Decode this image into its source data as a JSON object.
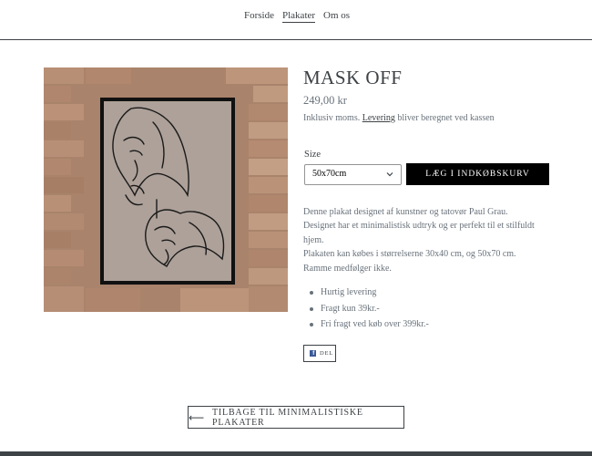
{
  "nav": {
    "items": [
      {
        "label": "Forside"
      },
      {
        "label": "Plakater"
      },
      {
        "label": "Om os"
      }
    ]
  },
  "product": {
    "title": "MASK OFF",
    "price": "249,00 kr",
    "tax_prefix": "Inklusiv moms. ",
    "tax_link": "Levering",
    "tax_suffix": " bliver beregnet ved kassen",
    "size_label": "Size",
    "size_selected": "50x70cm",
    "add_to_cart": "LÆG I INDKØBSKURV",
    "description": [
      "Denne plakat designet af kunstner og tatovør Paul Grau.",
      "Designet har et minimalistisk udtryk og er perfekt til et stilfuldt hjem.",
      "Plakaten kan købes i størrelserne 30x40 cm, og 50x70 cm.",
      "Ramme medfølger ikke."
    ],
    "bullets": [
      "Hurtig levering",
      "Fragt kun 39kr.-",
      "Fri fragt ved køb over 399kr.-"
    ],
    "share_label": "DEL"
  },
  "back_button": "TILBAGE TIL MINIMALISTISKE PLAKATER",
  "colors": {
    "text": "#3d4246",
    "muted": "#69727b",
    "button_bg": "#000000",
    "facebook": "#3b5998"
  }
}
